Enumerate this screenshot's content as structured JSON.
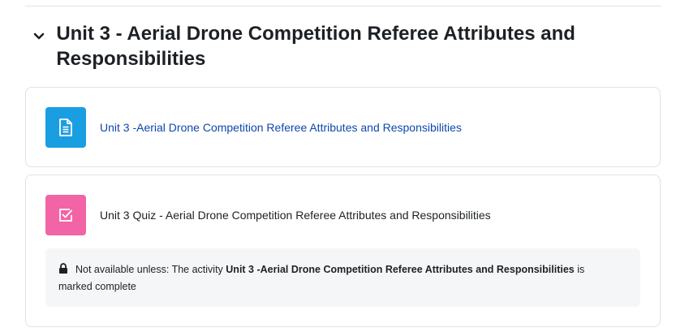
{
  "section": {
    "title": "Unit 3 - Aerial Drone Competition Referee Attributes and Responsibilities",
    "toggle_icon": "chevron-down-icon"
  },
  "activities": [
    {
      "type": "page",
      "icon": "page-document-icon",
      "icon_color": "#1a9ee2",
      "name": "Unit 3 -Aerial Drone Competition Referee Attributes and Responsibilities"
    },
    {
      "type": "quiz",
      "icon": "quiz-checkbox-icon",
      "icon_color": "#f264a6",
      "name": "Unit 3 Quiz - Aerial Drone Competition Referee Attributes and Responsibilities",
      "availability": {
        "icon": "lock-icon",
        "prefix": "Not available unless: The activity ",
        "activity_link": "Unit 3 -Aerial Drone Competition Referee Attributes and Responsibilities",
        "suffix_line1": " is",
        "suffix_line2": "marked complete"
      }
    }
  ],
  "colors": {
    "link": "#0f47ad",
    "border": "#dee2e6",
    "availability_bg": "#f5f6f7"
  }
}
